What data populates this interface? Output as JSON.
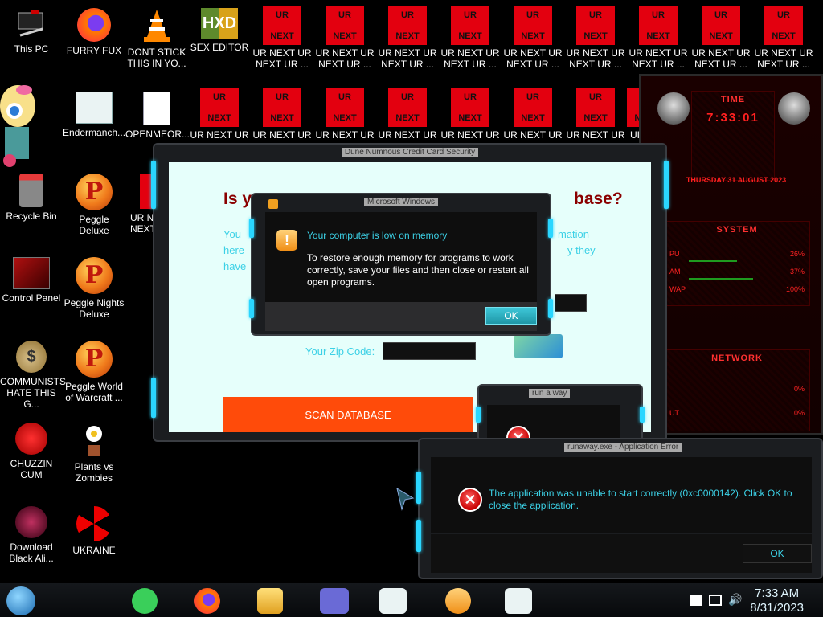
{
  "desktop_icons": [
    {
      "label": "This PC"
    },
    {
      "label": "FURRY FUX"
    },
    {
      "label": "DONT STICK THIS IN YO..."
    },
    {
      "label": "SEX EDITOR"
    },
    {
      "label": "Endermanch..."
    },
    {
      "label": "OPENMEOR..."
    },
    {
      "label": "Recycle Bin"
    },
    {
      "label": "Peggle Deluxe"
    },
    {
      "label": "UR NI NEXT"
    },
    {
      "label": "Control Panel"
    },
    {
      "label": "Peggle Nights Deluxe"
    },
    {
      "label": "COMMUNISTS HATE THIS G..."
    },
    {
      "label": "Peggle World of Warcraft ..."
    },
    {
      "label": "CHUZZIN CUM"
    },
    {
      "label": "Plants vs Zombies"
    },
    {
      "label": "Download Black Ali..."
    },
    {
      "label": "UKRAINE"
    }
  ],
  "ur_icon": {
    "top": "UR",
    "bottom": "NEXT",
    "label1": "UR NEXT UR",
    "label2": "NEXT UR ...",
    "label_short": "UR NEXT UR",
    "label_cut": "UI"
  },
  "widget": {
    "time_title": "TIME",
    "time": "7:33:01",
    "date": "THURSDAY 31 AUGUST 2023",
    "system_title": "SYSTEM",
    "cpu_label": "PU",
    "cpu_val": "26%",
    "ram_label": "AM",
    "ram_val": "37%",
    "swap_label": "WAP",
    "swap_val": "100%",
    "network_title": "NETWORK",
    "net_in_val": "0%",
    "net_out_label": "UT",
    "net_out_val": "0%"
  },
  "cc_window": {
    "title": "Dune Numnous Credit Card Security",
    "heading_left": "Is y",
    "heading_right": "base?",
    "text1_left": "You",
    "text1_right": "mation",
    "text2_left": "here",
    "text2_right": "y they",
    "text3_left": "have",
    "zip_label": "Your Zip Code:",
    "scan_button": "SCAN DATABASE"
  },
  "memory_dialog": {
    "title": "Microsoft Windows",
    "icon": "!",
    "heading": "Your computer is low on memory",
    "body": "To restore enough memory for programs to work correctly, save your files and then close or restart all open programs.",
    "ok": "OK"
  },
  "small_dialog": {
    "title": "run a way"
  },
  "error_dialog": {
    "title": "runaway.exe - Application Error",
    "message": "The application was unable to start correctly (0xc0000142). Click OK to close the application.",
    "ok": "OK"
  },
  "clock": {
    "time": "7:33 AM",
    "date": "8/31/2023"
  },
  "colors": {
    "accent": "#2ad6ff",
    "red": "#e3000f",
    "heading": "#8a0000",
    "scan": "#ff4b0a"
  }
}
